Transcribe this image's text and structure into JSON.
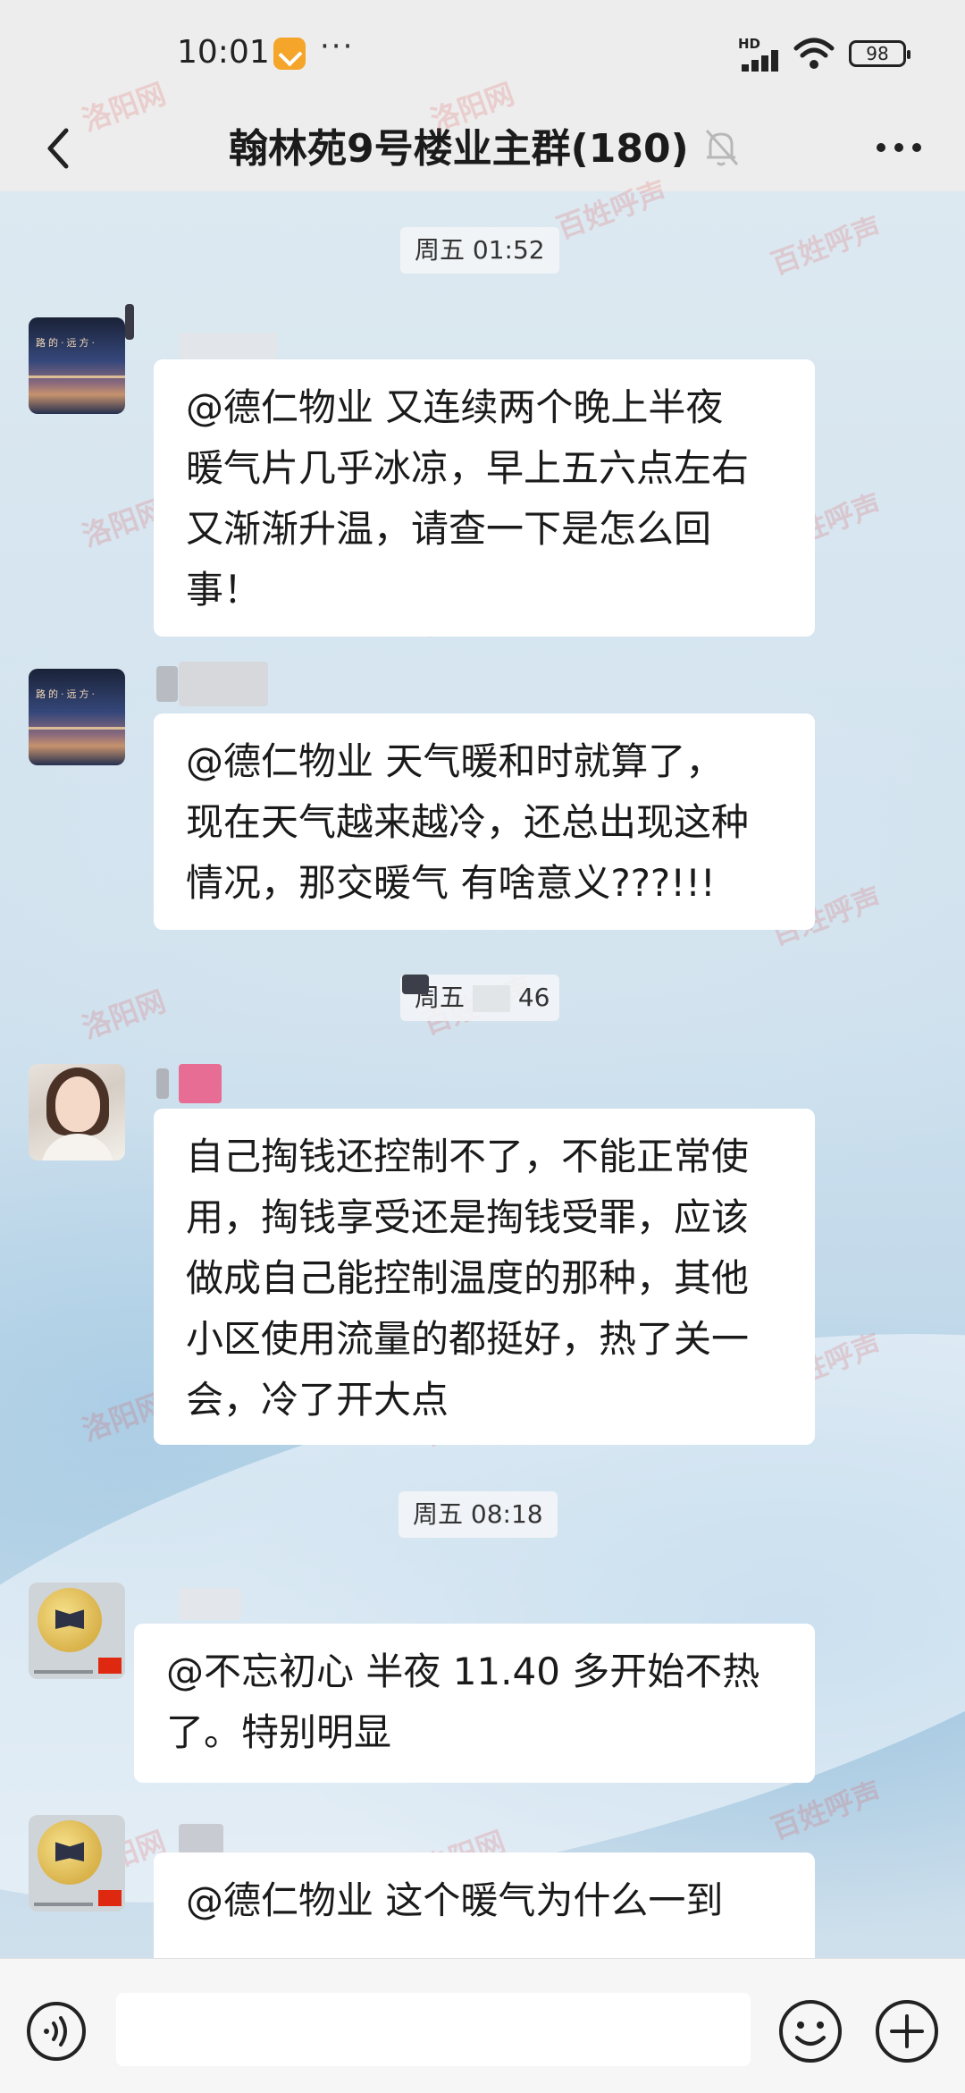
{
  "status_bar": {
    "time": "10:01",
    "more_indicator": "···",
    "network": "HD",
    "battery": "98"
  },
  "header": {
    "title": "翰林苑9号楼业主群(180)",
    "icons": [
      "back-chevron-icon",
      "mute-bell-icon",
      "more-dots-icon"
    ]
  },
  "chat": {
    "timestamps": [
      "周五 01:52",
      "周五",
      "46",
      "周五 08:18"
    ],
    "messages": [
      {
        "avatar": "night-sky-avatar",
        "lines": [
          "@德仁物业    又连续两个晚上半夜",
          "暖气片几乎冰凉，早上五六点左右",
          "又渐渐升温，请查一下是怎么回",
          "事！"
        ]
      },
      {
        "avatar": "night-sky-avatar",
        "lines": [
          "@德仁物业  天气暖和时就算了，",
          "现在天气越来越冷，还总出现这种",
          "情况，那交暖气    有啥意义???!!!"
        ]
      },
      {
        "avatar": "woman-avatar",
        "lines": [
          "自己掏钱还控制不了，不能正常使",
          "用，掏钱享受还是掏钱受罪，应该",
          "做成自己能控制温度的那种，其他",
          "小区使用流量的都挺好，热了关一",
          "会，冷了开大点"
        ]
      },
      {
        "avatar": "moon-book-avatar",
        "lines": [
          "@不忘初心  半夜 11.40 多开始不热",
          "了。特别明显"
        ]
      },
      {
        "avatar": "moon-book-avatar",
        "lines": [
          "@德仁物业  这个暖气为什么一到"
        ]
      }
    ]
  },
  "watermark": {
    "text": "洛阳网",
    "box_text": "百姓呼声"
  },
  "bottom_bar": {
    "icons": [
      "voice-icon",
      "emoji-icon",
      "plus-icon"
    ],
    "input_value": ""
  }
}
